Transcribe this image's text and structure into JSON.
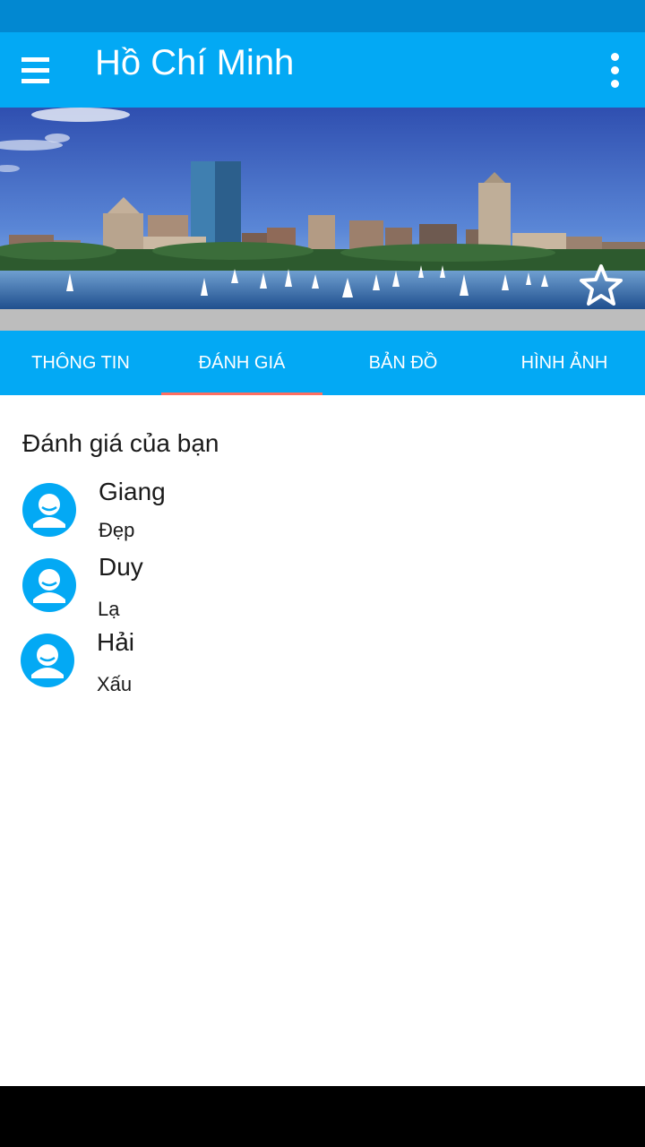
{
  "app_bar": {
    "title": "Hồ Chí Minh",
    "menu_icon": "hamburger-menu-icon",
    "overflow_icon": "more-vert-icon",
    "background": "#03a9f4"
  },
  "status_bar": {
    "background": "#0288d1"
  },
  "hero": {
    "favorite_icon": "star-outline-icon"
  },
  "tabs": [
    {
      "label": "THÔNG TIN",
      "active": false
    },
    {
      "label": "ĐÁNH GIÁ",
      "active": true
    },
    {
      "label": "BẢN ĐỒ",
      "active": false
    },
    {
      "label": "HÌNH ẢNH",
      "active": false
    }
  ],
  "tab_indicator_color": "#ff6f61",
  "reviews_section": {
    "title": "Đánh giá của bạn",
    "items": [
      {
        "name": "Giang",
        "comment": "Đẹp",
        "avatar_icon": "person-avatar-icon"
      },
      {
        "name": "Duy",
        "comment": "Lạ",
        "avatar_icon": "person-avatar-icon"
      },
      {
        "name": "Hải",
        "comment": "Xấu",
        "avatar_icon": "person-avatar-icon"
      }
    ]
  }
}
